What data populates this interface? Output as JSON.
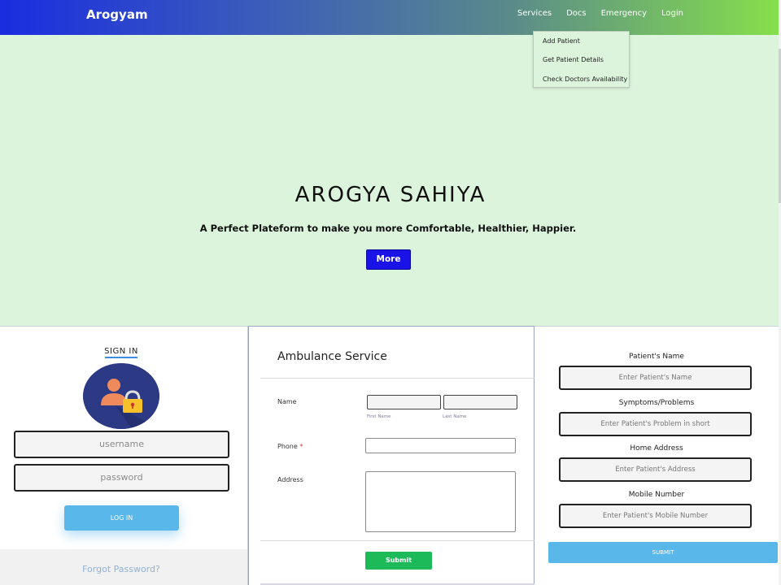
{
  "navbar": {
    "brand": "Arogyam",
    "links": [
      "Services",
      "Docs",
      "Emergency",
      "Login"
    ]
  },
  "services_dropdown": {
    "items": [
      "Add Patient",
      "Get Patient Details",
      "Check Doctors Availability"
    ]
  },
  "hero": {
    "title": "AROGYA SAHIYA",
    "subtitle": "A Perfect Plateform to make you more Comfortable, Healthier, Happier.",
    "button_label": "More"
  },
  "signin": {
    "title": "SIGN IN",
    "username_placeholder": "username",
    "password_placeholder": "password",
    "login_label": "LOG IN",
    "forgot_label": "Forgot Password?"
  },
  "ambulance": {
    "title": "Ambulance Service",
    "name_label": "Name",
    "first_name_label": "First Name",
    "last_name_label": "Last Name",
    "phone_label": "Phone",
    "phone_required_mark": "*",
    "address_label": "Address",
    "submit_label": "Submit"
  },
  "patient_form": {
    "name_label": "Patient's Name",
    "name_placeholder": "Enter Patient's Name",
    "symptoms_label": "Symptoms/Problems",
    "symptoms_placeholder": "Enter Patient's Problem in short",
    "address_label": "Home Address",
    "address_placeholder": "Enter Patient's Address",
    "mobile_label": "Mobile Number",
    "mobile_placeholder": "Enter Patient's Mobile Number",
    "submit_label": "SUBMIT"
  },
  "colors": {
    "hero_bg": "#dcf3dc",
    "more_button": "#1a13e8",
    "login_button": "#59b7ea",
    "ambulance_submit": "#1dba5a",
    "navbar_start": "#1a2de0",
    "navbar_end": "#86e04a"
  },
  "icons": {
    "avatar": "user-lock-icon"
  }
}
